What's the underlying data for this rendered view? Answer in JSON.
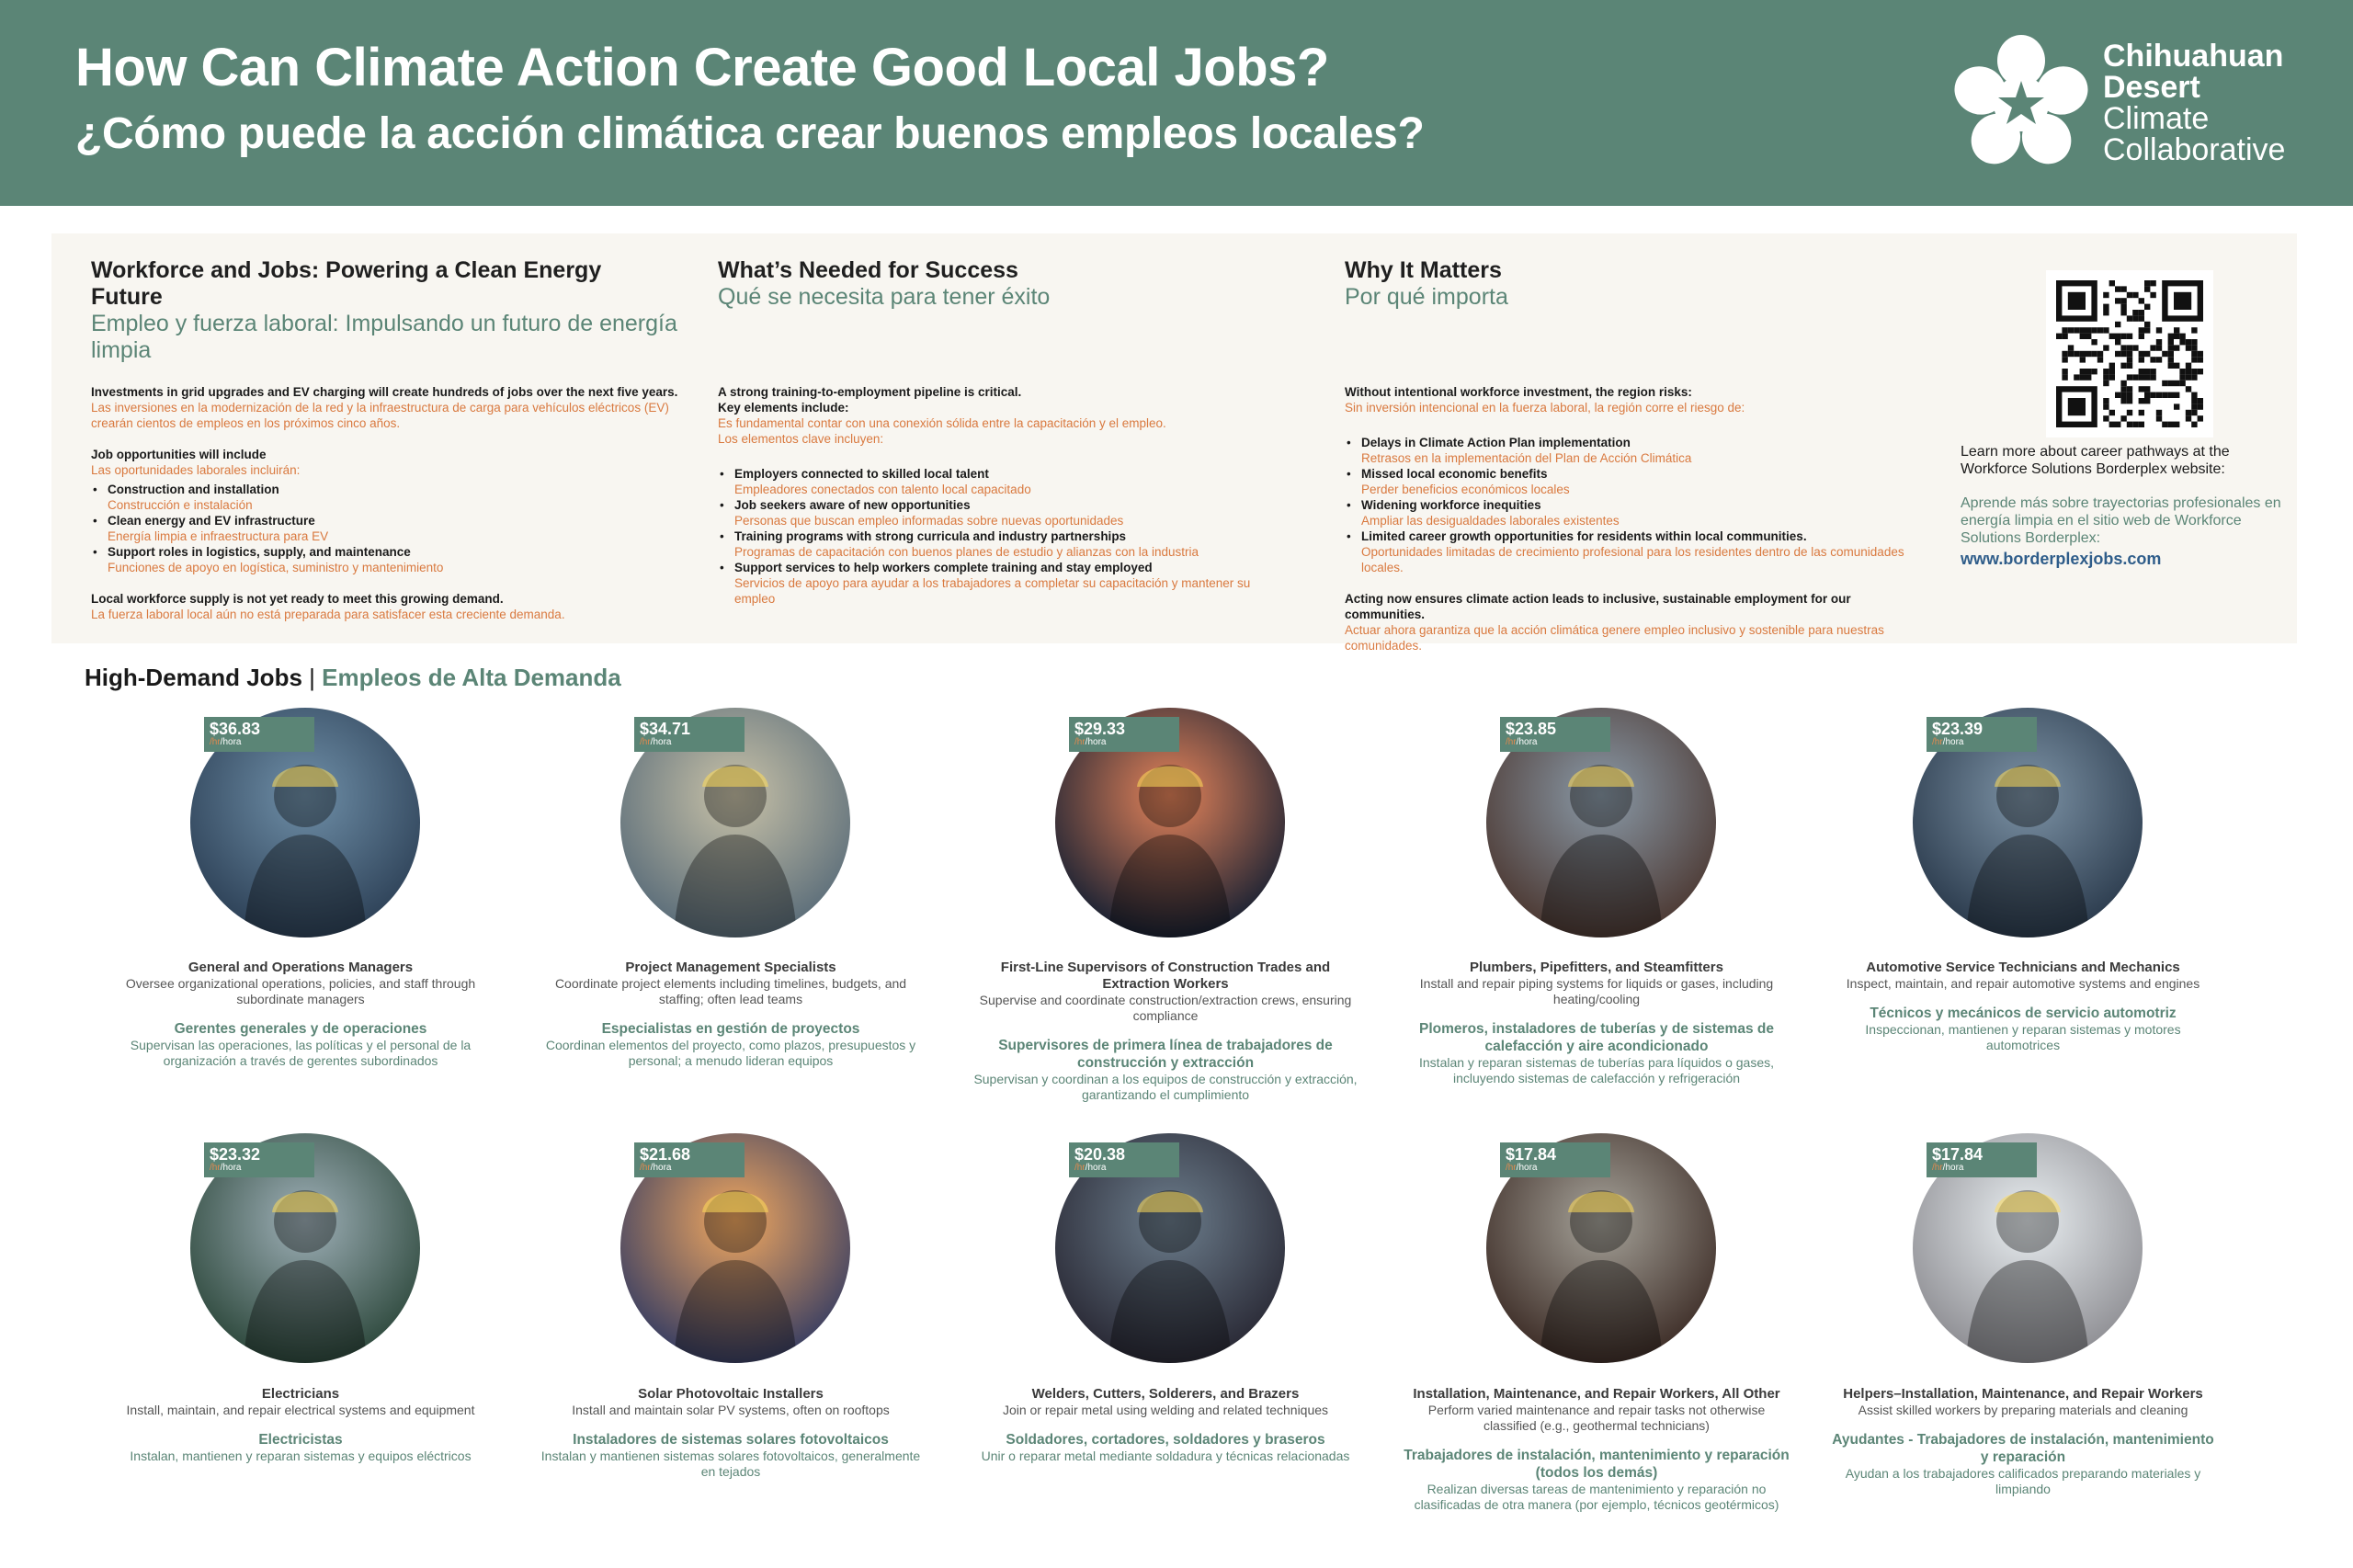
{
  "header": {
    "title_en": "How Can Climate Action Create Good Local Jobs?",
    "title_es": "¿Cómo puede la acción climática crear buenos empleos locales?",
    "logo_lines": [
      "Chihuahuan",
      "Desert",
      "Climate",
      "Collaborative"
    ]
  },
  "columns": {
    "workforce": {
      "heading_en": "Workforce and Jobs: Powering a Clean Energy Future",
      "heading_es": "Empleo y fuerza laboral: Impulsando un futuro de energía limpia",
      "p1_en": "Investments in grid upgrades and EV charging will create hundreds of jobs over the next five years.",
      "p1_es": "Las inversiones en la modernización de la red y la infraestructura de carga para vehículos eléctricos (EV) crearán cientos de empleos en los próximos cinco años.",
      "p2_en": "Job opportunities will include",
      "p2_es": "Las oportunidades laborales incluirán:",
      "items": [
        {
          "en": "Construction and installation",
          "es": "Construcción e instalación"
        },
        {
          "en": "Clean energy and EV infrastructure",
          "es": "Energía limpia e infraestructura para EV"
        },
        {
          "en": "Support roles in logistics, supply, and maintenance",
          "es": "Funciones de apoyo en logística, suministro y mantenimiento"
        }
      ],
      "p3_en": "Local workforce supply is not yet ready to meet this growing demand.",
      "p3_es": "La fuerza laboral local aún no está preparada para satisfacer esta creciente demanda."
    },
    "success": {
      "heading_en": "What’s Needed for Success",
      "heading_es": "Qué se necesita para tener éxito",
      "p1_en": "A strong training-to-employment pipeline is critical.",
      "p1b_en": "Key elements include:",
      "p1_es": "Es fundamental contar con una conexión sólida entre la capacitación y el empleo.",
      "p1b_es": "Los elementos clave incluyen:",
      "items": [
        {
          "en": "Employers connected to skilled local talent",
          "es": "Empleadores conectados con talento local capacitado"
        },
        {
          "en": "Job seekers aware of new opportunities",
          "es": "Personas que buscan empleo informadas sobre nuevas oportunidades"
        },
        {
          "en": "Training programs with strong curricula and industry partnerships",
          "es": "Programas de capacitación con buenos planes de estudio y alianzas con la industria"
        },
        {
          "en": "Support services to help workers complete training and stay employed",
          "es": "Servicios de apoyo para ayudar a los trabajadores a completar su capacitación y mantener su empleo"
        }
      ]
    },
    "matters": {
      "heading_en": "Why It Matters",
      "heading_es": "Por qué importa",
      "p1_en": "Without intentional workforce investment, the region risks:",
      "p1_es": "Sin inversión intencional en la fuerza laboral, la región corre el riesgo de:",
      "items": [
        {
          "en": "Delays in Climate Action Plan implementation",
          "es": "Retrasos en la implementación del Plan de Acción Climática"
        },
        {
          "en": "Missed local economic benefits",
          "es": "Perder beneficios económicos locales"
        },
        {
          "en": "Widening workforce inequities",
          "es": "Ampliar las desigualdades laborales existentes"
        },
        {
          "en": "Limited career growth opportunities for residents within local communities.",
          "es": "Oportunidades limitadas de crecimiento profesional para los residentes dentro de las comunidades locales."
        }
      ],
      "p2_en": "Acting now ensures climate action leads to inclusive, sustainable employment for our communities.",
      "p2_es": "Actuar ahora garantiza que la acción climática genere empleo inclusivo y sostenible para nuestras comunidades."
    }
  },
  "qr": {
    "text_en": "Learn more about career pathways at the Workforce Solutions Borderplex website:",
    "text_es": "Aprende más sobre trayectorias profesionales en energía limpia en el sitio web de Workforce Solutions Borderplex:",
    "url": "www.borderplexjobs.com"
  },
  "high_demand": {
    "title_en": "High-Demand Jobs",
    "separator": "|",
    "title_es": "Empleos de Alta Demanda",
    "unit_en": "/hr",
    "unit_es": "/hora",
    "jobs": [
      {
        "wage": "$36.83",
        "title_en": "General and Operations Managers",
        "desc_en": "Oversee organizational operations, policies, and staff through subordinate managers",
        "title_es": "Gerentes generales y de operaciones",
        "desc_es": "Supervisan las operaciones, las políticas y el personal de la organización a través de gerentes subordinados"
      },
      {
        "wage": "$34.71",
        "title_en": "Project Management Specialists",
        "desc_en": "Coordinate project elements including timelines, budgets, and staffing; often lead teams",
        "title_es": "Especialistas en gestión de proyectos",
        "desc_es": "Coordinan elementos del proyecto, como plazos, presupuestos y personal; a menudo lideran equipos"
      },
      {
        "wage": "$29.33",
        "title_en": "First-Line Supervisors of Construction Trades and Extraction Workers",
        "desc_en": "Supervise and coordinate construction/extraction crews, ensuring compliance",
        "title_es": "Supervisores de primera línea de trabajadores de construcción y extracción",
        "desc_es": "Supervisan y coordinan a los equipos de construcción y extracción, garantizando el cumplimiento"
      },
      {
        "wage": "$23.85",
        "title_en": "Plumbers, Pipefitters, and Steamfitters",
        "desc_en": "Install and repair piping systems for liquids or gases, including heating/cooling",
        "title_es": "Plomeros, instaladores de tuberías y de sistemas de calefacción y aire acondicionado",
        "desc_es": "Instalan y reparan sistemas de tuberías para líquidos o gases, incluyendo sistemas de calefacción y refrigeración"
      },
      {
        "wage": "$23.39",
        "title_en": "Automotive Service Technicians and Mechanics",
        "desc_en": "Inspect, maintain, and repair automotive systems and engines",
        "title_es": "Técnicos y mecánicos de servicio automotriz",
        "desc_es": "Inspeccionan, mantienen y reparan sistemas y motores automotrices"
      },
      {
        "wage": "$23.32",
        "title_en": "Electricians",
        "desc_en": "Install, maintain, and repair electrical systems and equipment",
        "title_es": "Electricistas",
        "desc_es": "Instalan, mantienen y reparan sistemas y equipos eléctricos"
      },
      {
        "wage": "$21.68",
        "title_en": "Solar Photovoltaic Installers",
        "desc_en": "Install and maintain solar PV systems, often on rooftops",
        "title_es": "Instaladores de sistemas solares fotovoltaicos",
        "desc_es": "Instalan y mantienen sistemas solares fotovoltaicos, generalmente en tejados"
      },
      {
        "wage": "$20.38",
        "title_en": "Welders, Cutters, Solderers, and Brazers",
        "desc_en": "Join or repair metal using welding and related techniques",
        "title_es": "Soldadores, cortadores, soldadores y braseros",
        "desc_es": "Unir o reparar metal mediante soldadura y técnicas relacionadas"
      },
      {
        "wage": "$17.84",
        "title_en": "Installation, Maintenance, and Repair Workers, All Other",
        "desc_en": "Perform varied maintenance and repair tasks not otherwise classified (e.g., geothermal technicians)",
        "title_es": "Trabajadores de instalación, mantenimiento y reparación (todos los demás)",
        "desc_es": "Realizan diversas tareas de mantenimiento y reparación no clasificadas de otra manera (por ejemplo, técnicos geotérmicos)"
      },
      {
        "wage": "$17.84",
        "title_en": "Helpers–Installation, Maintenance, and Repair Workers",
        "desc_en": "Assist skilled workers by preparing materials and cleaning",
        "title_es": "Ayudantes - Trabajadores de instalación, mantenimiento y reparación",
        "desc_es": "Ayudan a los trabajadores calificados preparando materiales y limpiando"
      }
    ]
  },
  "colors": {
    "brand_green": "#5b8576",
    "accent_orange": "#d9793f",
    "link_blue": "#2f5d8a"
  }
}
